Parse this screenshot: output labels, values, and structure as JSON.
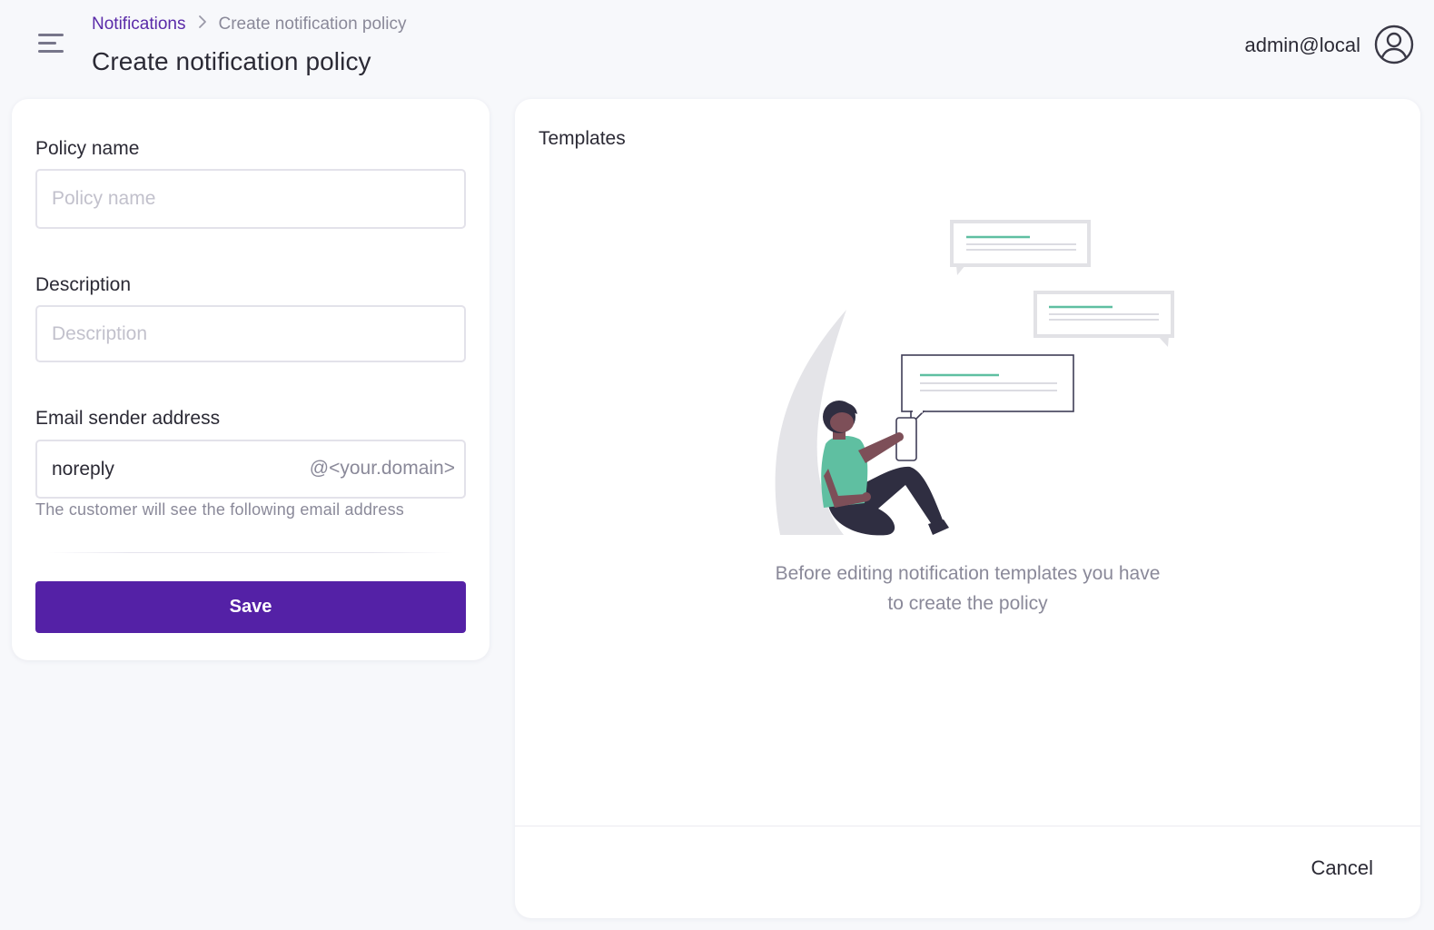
{
  "header": {
    "breadcrumb": {
      "parent": "Notifications",
      "separator": "›",
      "current": "Create notification policy"
    },
    "title": "Create notification policy",
    "user_email": "admin@local",
    "icons": {
      "menu": "hamburger-menu-icon",
      "user": "user-circle-icon"
    }
  },
  "form": {
    "policy_name": {
      "label": "Policy name",
      "value": "",
      "placeholder": "Policy name"
    },
    "description": {
      "label": "Description",
      "value": "",
      "placeholder": "Description"
    },
    "email_sender": {
      "label": "Email sender address",
      "value": "noreply",
      "suffix": "@<your.domain>",
      "helper": "The customer will see the following email address"
    },
    "save_label": "Save"
  },
  "templates": {
    "title": "Templates",
    "message_line1": "Before editing notification templates you have",
    "message_line2": "to create the policy",
    "cancel_label": "Cancel"
  },
  "colors": {
    "accent": "#5421a6",
    "link": "#5a2aa8",
    "illustration_green": "#5fbfa1",
    "background": "#f7f8fb"
  }
}
